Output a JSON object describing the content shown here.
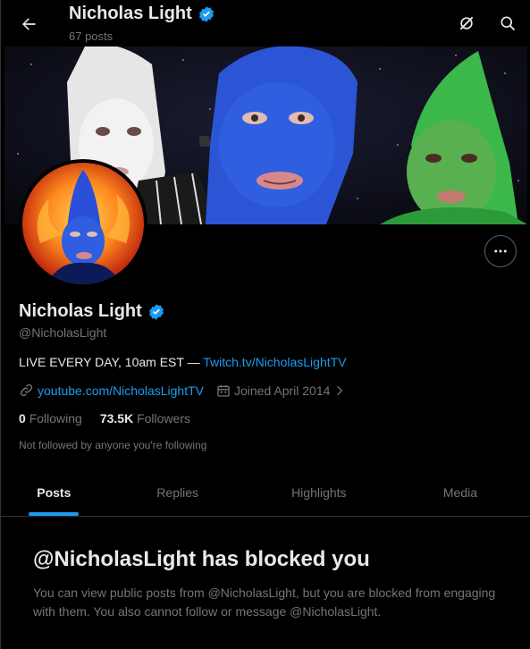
{
  "header": {
    "title": "Nicholas Light",
    "posts_count": "67 posts"
  },
  "profile": {
    "name": "Nicholas Light",
    "handle": "@NicholasLight",
    "bio_text": "LIVE EVERY DAY, 10am EST — ",
    "bio_link": "Twitch.tv/NicholasLightTV",
    "website": "youtube.com/NicholasLightTV",
    "joined": "Joined April 2014",
    "following_count": "0",
    "following_label": "Following",
    "followers_count": "73.5K",
    "followers_label": "Followers",
    "not_followed": "Not followed by anyone you're following"
  },
  "tabs": [
    {
      "label": "Posts"
    },
    {
      "label": "Replies"
    },
    {
      "label": "Highlights"
    },
    {
      "label": "Media"
    }
  ],
  "blocked": {
    "title": "@NicholasLight has blocked you",
    "body": "You can view public posts from @NicholasLight, but you are blocked from engaging with them. You also cannot follow or message @NicholasLight."
  },
  "colors": {
    "accent": "#1d9bf0",
    "background": "#000000",
    "muted": "#71767b",
    "text": "#e7e9ea"
  },
  "icons": [
    "back-arrow-icon",
    "verified-badge-icon",
    "grok-icon",
    "search-icon",
    "more-dots-icon",
    "link-icon",
    "calendar-icon",
    "chevron-right-icon"
  ]
}
